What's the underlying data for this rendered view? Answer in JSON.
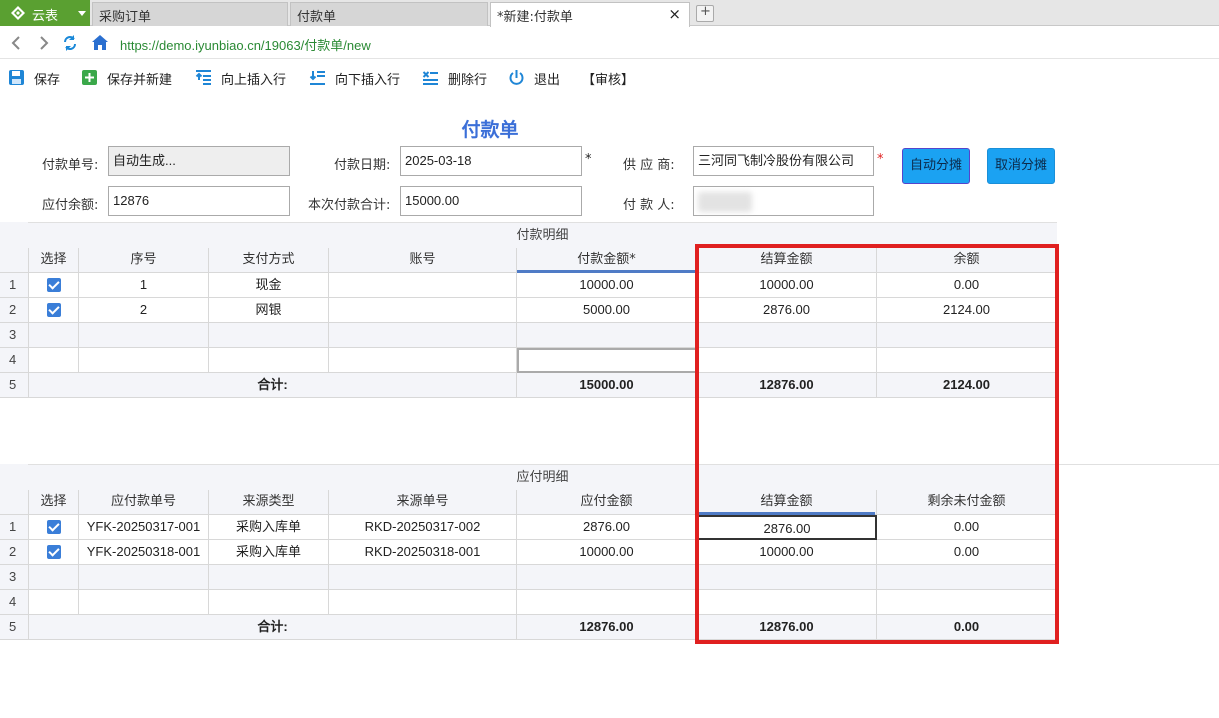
{
  "tabs": {
    "home": "云表",
    "items": [
      {
        "label": "采购订单"
      },
      {
        "label": "付款单"
      },
      {
        "label": "*新建:付款单"
      }
    ],
    "close": "×",
    "add": "+"
  },
  "address": {
    "url": "https://demo.iyunbiao.cn/19063/付款单/new"
  },
  "toolbar": {
    "save": "保存",
    "save_new": "保存并新建",
    "insert_up": "向上插入行",
    "insert_down": "向下插入行",
    "delete_row": "删除行",
    "exit": "退出",
    "audit": "【审核】"
  },
  "form": {
    "title": "付款单",
    "order_no_label": "付款单号:",
    "order_no_value": "自动生成...",
    "date_label": "付款日期:",
    "date_value": "2025-03-18",
    "supplier_label": "供  应  商:",
    "supplier_value": "三河同飞制冷股份有限公司",
    "balance_label": "应付余额:",
    "balance_value": "12876",
    "total_label": "本次付款合计:",
    "total_value": "15000.00",
    "payer_label": "付  款  人:",
    "required_mark": "*",
    "auto_alloc": "自动分摊",
    "cancel_alloc": "取消分摊"
  },
  "payment_detail": {
    "caption": "付款明细",
    "headers": [
      "选择",
      "序号",
      "支付方式",
      "账号",
      "付款金额*",
      "结算金额",
      "余额"
    ],
    "row_numbers": [
      "1",
      "2",
      "3",
      "4",
      "5"
    ],
    "rows": [
      {
        "seq": "1",
        "method": "现金",
        "account": "",
        "amount": "10000.00",
        "settle": "10000.00",
        "balance": "0.00"
      },
      {
        "seq": "2",
        "method": "网银",
        "account": "",
        "amount": "5000.00",
        "settle": "2876.00",
        "balance": "2124.00"
      }
    ],
    "total_label": "合计:",
    "total_amount": "15000.00",
    "total_settle": "12876.00",
    "total_balance": "2124.00"
  },
  "payable_detail": {
    "caption": "应付明细",
    "headers": [
      "选择",
      "应付款单号",
      "来源类型",
      "来源单号",
      "应付金额",
      "结算金额",
      "剩余未付金额"
    ],
    "row_numbers": [
      "1",
      "2",
      "3",
      "4",
      "5"
    ],
    "rows": [
      {
        "no": "YFK-20250317-001",
        "type": "采购入库单",
        "src": "RKD-20250317-002",
        "amount": "2876.00",
        "settle": "2876.00",
        "remain": "0.00"
      },
      {
        "no": "YFK-20250318-001",
        "type": "采购入库单",
        "src": "RKD-20250318-001",
        "amount": "10000.00",
        "settle": "10000.00",
        "remain": "0.00"
      }
    ],
    "total_label": "合计:",
    "total_amount": "12876.00",
    "total_settle": "12876.00",
    "total_remain": "0.00"
  },
  "colors": {
    "accent": "#3b6fd8",
    "home_tab": "#5aa031",
    "highlight_box": "#e02020",
    "button": "#1ba2f2"
  }
}
